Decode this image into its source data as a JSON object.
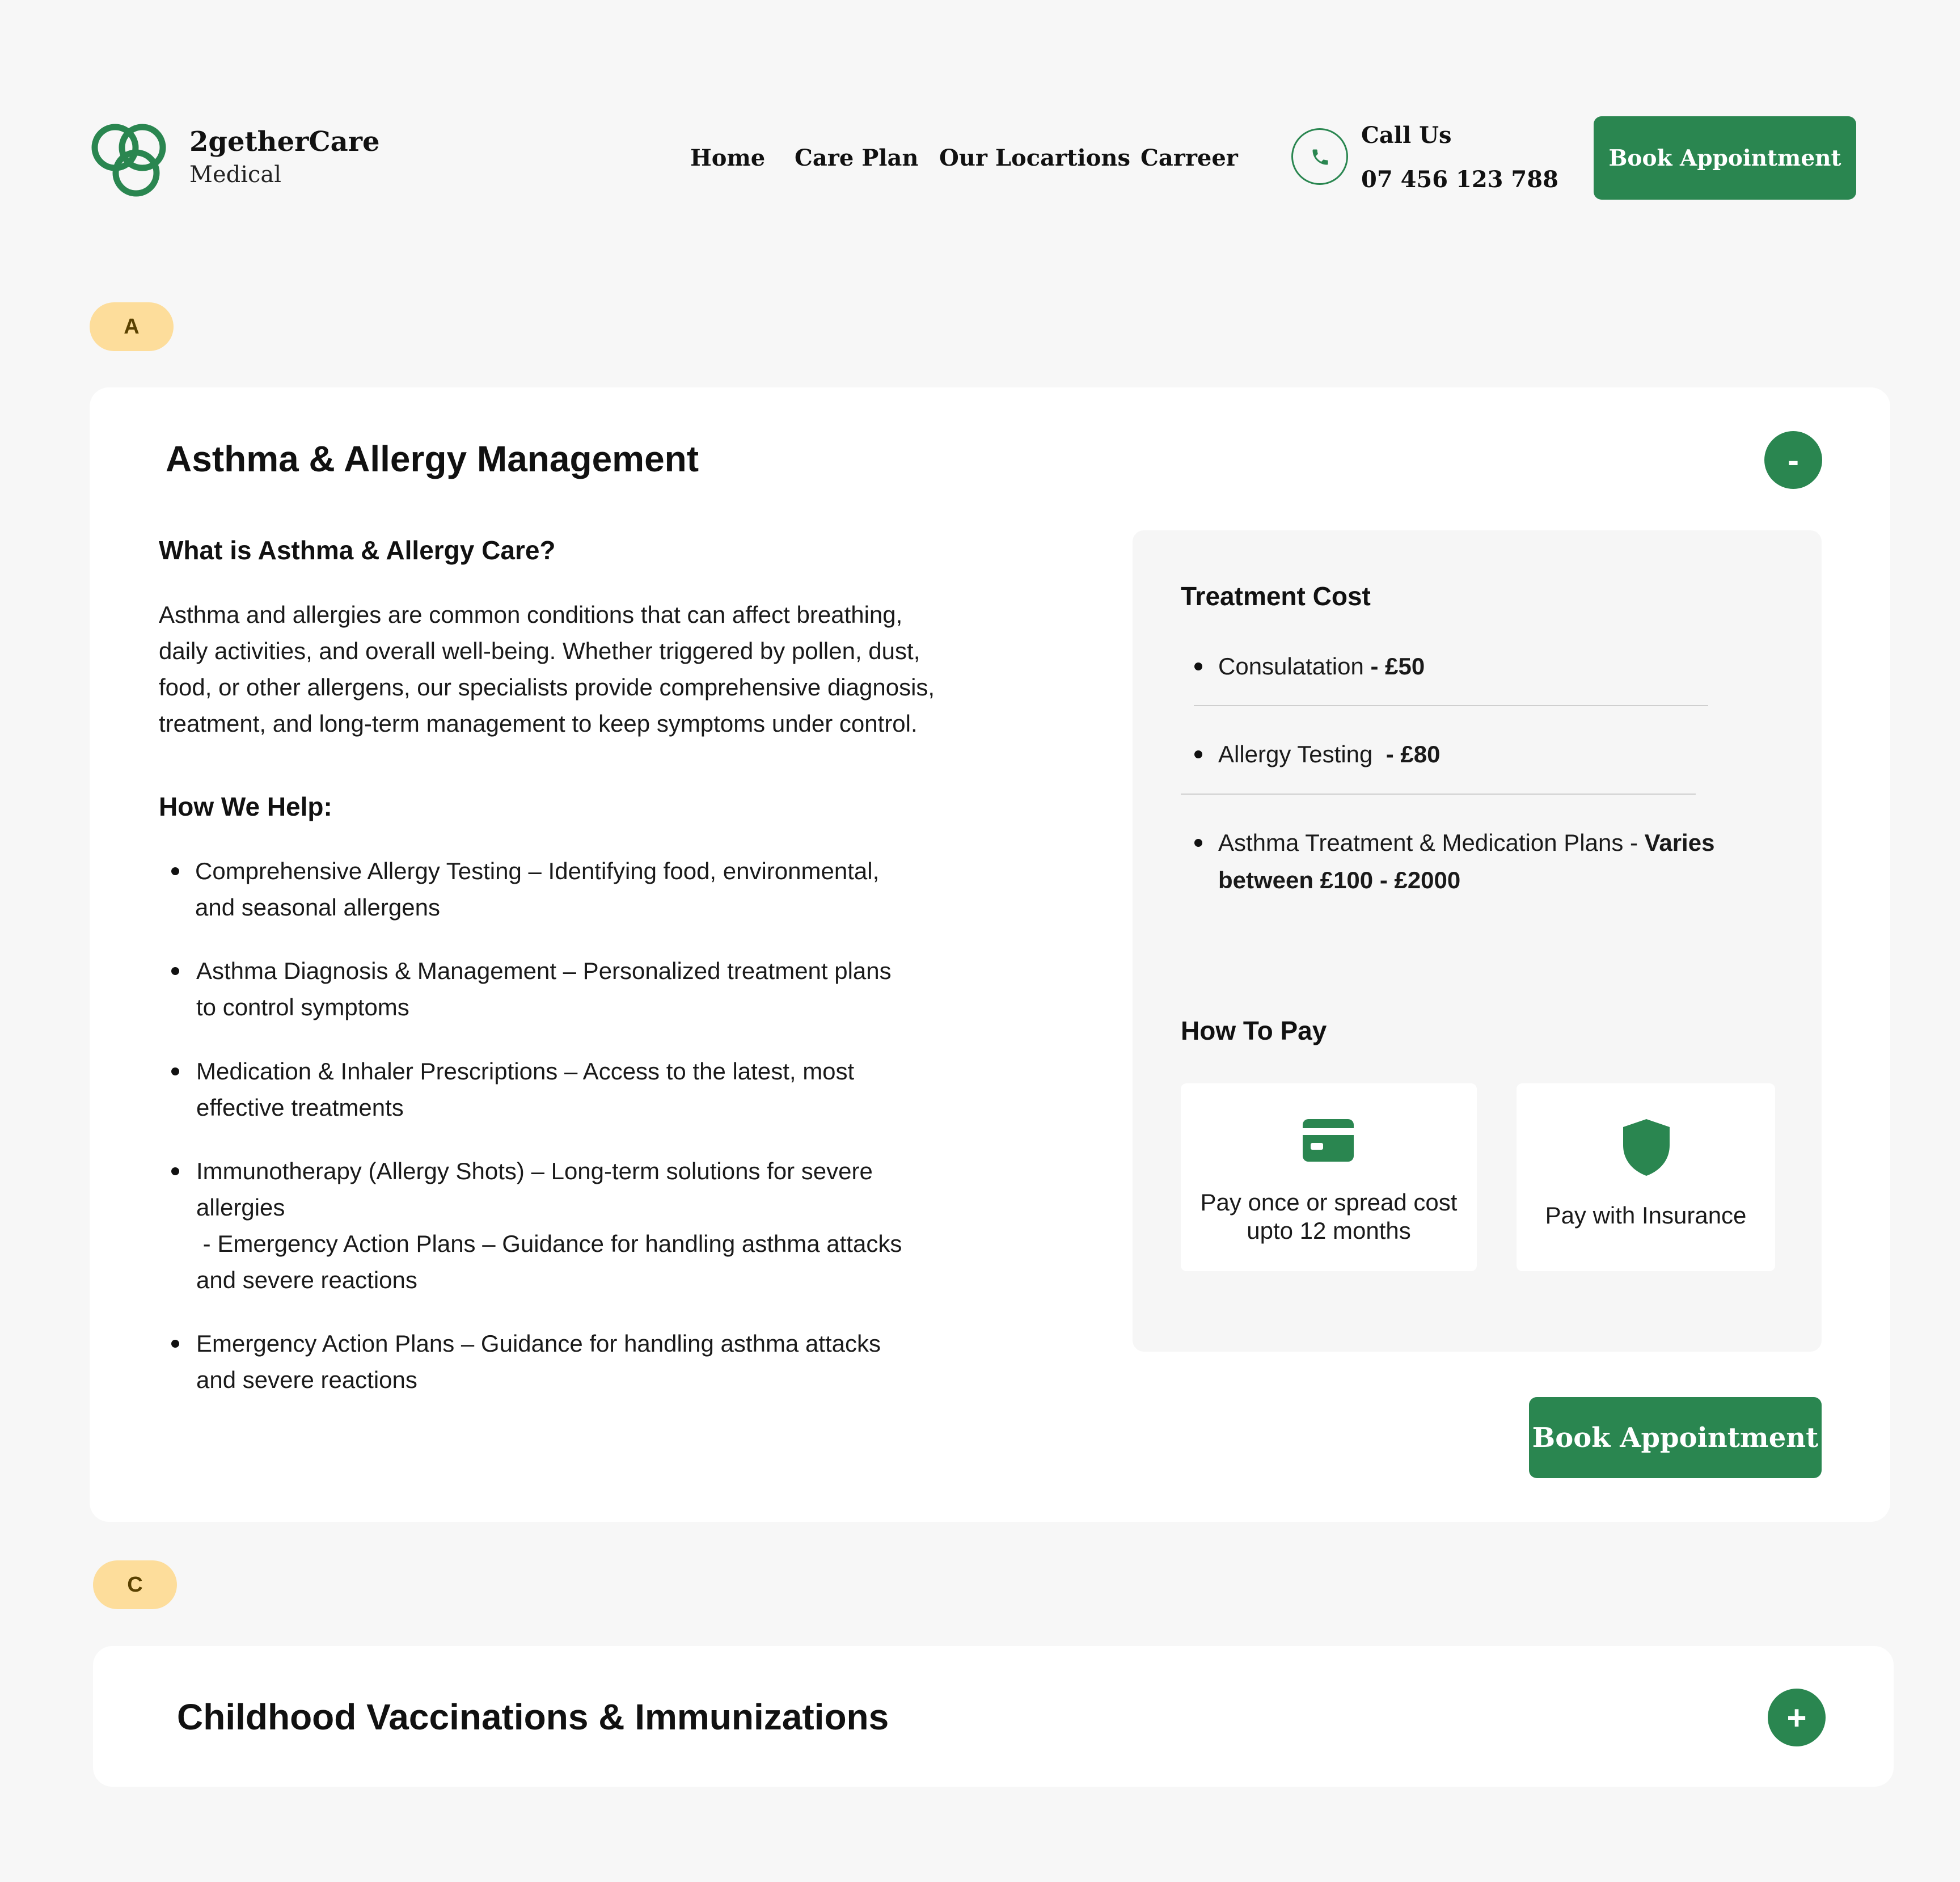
{
  "brand": {
    "name": "2getherCare",
    "subtitle": "Medical",
    "color": "#2a8650"
  },
  "nav": {
    "items": [
      {
        "label": "Home"
      },
      {
        "label": "Care Plan"
      },
      {
        "label": "Our Locartions"
      },
      {
        "label": "Carreer"
      }
    ]
  },
  "contact": {
    "label": "Call Us",
    "phone": "07 456 123 788",
    "icon": "phone-icon"
  },
  "header_button": {
    "label": "Book Appointment"
  },
  "sections": [
    {
      "letter": "A",
      "title": "Asthma & Allergy Management",
      "toggle": "-",
      "what_heading": "What is Asthma & Allergy Care?",
      "description": [
        "Asthma and allergies are common conditions that can affect breathing,",
        "daily activities, and overall well-being. Whether triggered by pollen, dust,",
        "food, or other allergens, our specialists provide comprehensive diagnosis,",
        "treatment, and long-term management to keep symptoms under control."
      ],
      "help_heading": "How We Help:",
      "help_items": [
        [
          "Comprehensive Allergy Testing – Identifying food, environmental,",
          "and seasonal allergens"
        ],
        [
          "Asthma Diagnosis & Management – Personalized treatment plans",
          "to control symptoms"
        ],
        [
          "Medication & Inhaler Prescriptions – Access to the latest, most",
          "effective treatments"
        ],
        [
          "Immunotherapy (Allergy Shots) – Long-term solutions for severe",
          "allergies",
          " - Emergency Action Plans – Guidance for handling asthma attacks",
          "and severe reactions"
        ],
        [
          "Emergency Action Plans – Guidance for handling asthma attacks",
          "and severe reactions"
        ]
      ],
      "cost_heading": "Treatment Cost",
      "costs": [
        {
          "name": "Consulatation",
          "price": "- £50"
        },
        {
          "name": "Allergy Testing",
          "price": " - £80"
        },
        {
          "name": "Asthma Treatment & Medication Plans -",
          "price": "Varies",
          "price_line2": "between £100 - £2000"
        }
      ],
      "pay_heading": "How To Pay",
      "pay_options": [
        {
          "icon": "credit-card-icon",
          "line1": "Pay once or spread cost",
          "line2": "upto 12 months"
        },
        {
          "icon": "shield-icon",
          "line1": "Pay with Insurance"
        }
      ],
      "button": "Book Appointment"
    },
    {
      "letter": "C",
      "title": "Childhood Vaccinations & Immunizations",
      "toggle": "+"
    }
  ]
}
